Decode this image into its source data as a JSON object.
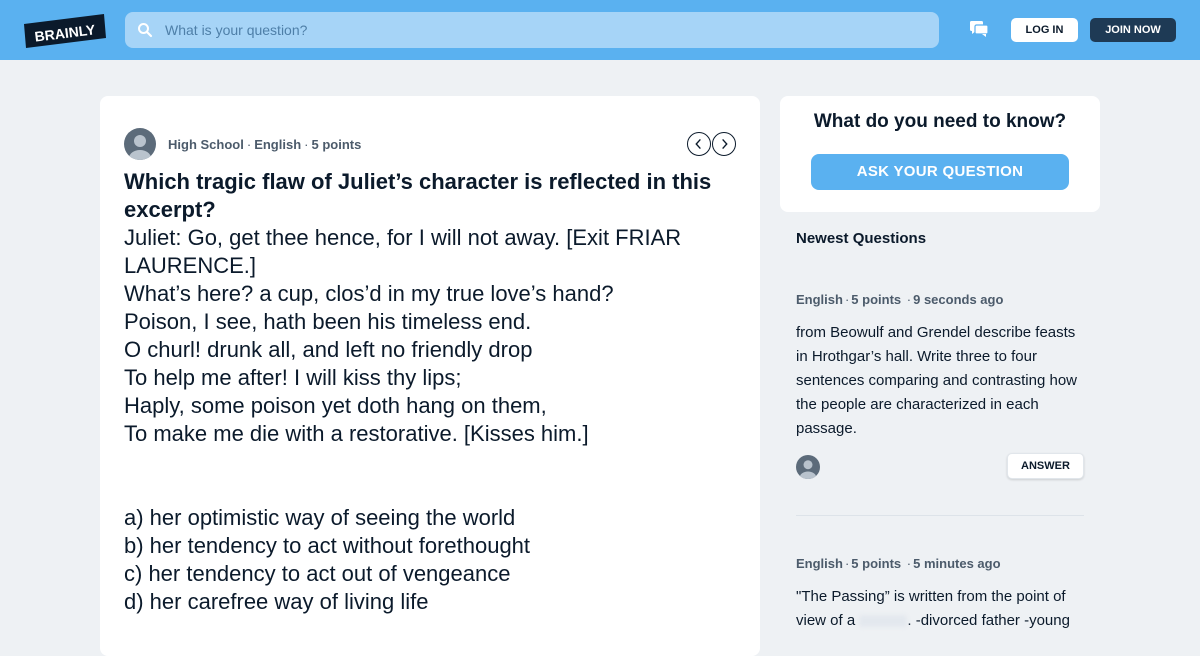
{
  "header": {
    "logo_text": "BRAINLY",
    "search_placeholder": "What is your question?",
    "login_label": "LOG IN",
    "join_label": "JOIN NOW",
    "brand_color": "#5ab1f0",
    "join_color": "#1e3a55"
  },
  "question": {
    "level": "High School",
    "subject": "English",
    "points": "5 points",
    "title": "Which tragic flaw of Juliet’s character is reflected in this excerpt?",
    "body_lines": [
      "Juliet: Go, get thee hence, for I will not away. [Exit FRIAR LAURENCE.]",
      "What’s here? a cup, clos’d in my true love’s hand?",
      "Poison, I see, hath been his timeless end.",
      "O churl! drunk all, and left no friendly drop",
      "To help me after! I will kiss thy lips;",
      "Haply, some poison yet doth hang on them,",
      "To make me die with a restorative. [Kisses him.]"
    ],
    "options": [
      "a) her optimistic way of seeing the world",
      "b) her tendency to act without forethought",
      "c) her tendency to act out of vengeance",
      "d) her carefree way of living life"
    ]
  },
  "ask": {
    "title": "What do you need to know?",
    "button_label": "ASK YOUR QUESTION"
  },
  "newest": {
    "heading": "Newest Questions",
    "items": [
      {
        "subject": "English",
        "points": "5 points",
        "time": "9 seconds ago",
        "text": "from Beowulf and Grendel describe feasts in Hrothgar’s hall. Write three to four sentences comparing and contrasting how the people are characterized in each passage.",
        "answer_label": "ANSWER"
      },
      {
        "subject": "English",
        "points": "5 points",
        "time": "5 minutes ago",
        "text_before": "\"The Passing” is written from the point of view of a",
        "text_after": ". -divorced father -young"
      }
    ]
  }
}
